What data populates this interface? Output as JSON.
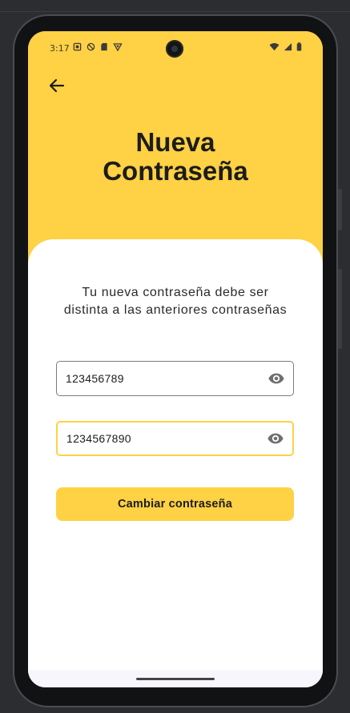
{
  "status_bar": {
    "time": "3:17"
  },
  "header": {
    "back_icon": "arrow-left-icon",
    "title_line1": "Nueva",
    "title_line2": "Contraseña"
  },
  "form": {
    "subtitle": "Tu nueva contraseña debe ser distinta a las anteriores contraseñas",
    "password_value": "123456789",
    "confirm_password_value": "1234567890",
    "visibility_icon": "eye-icon",
    "submit_label": "Cambiar contraseña"
  },
  "colors": {
    "accent": "#ffd144",
    "background": "#ffffff",
    "text": "#1c1c1c",
    "field_border": "#7b7b7b"
  }
}
